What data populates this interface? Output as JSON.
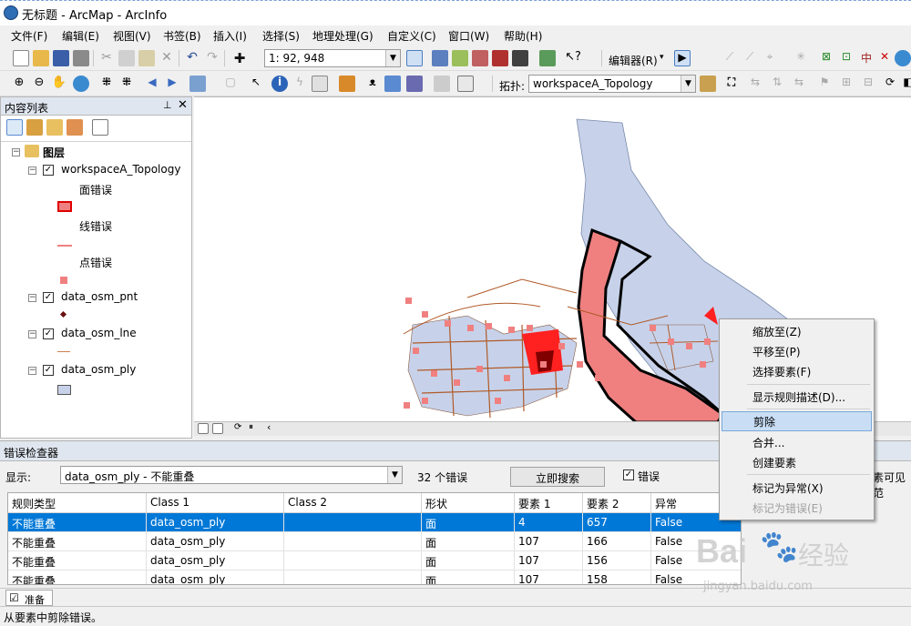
{
  "window": {
    "title": "无标题 - ArcMap - ArcInfo"
  },
  "menu": [
    "文件(F)",
    "编辑(E)",
    "视图(V)",
    "书签(B)",
    "插入(I)",
    "选择(S)",
    "地理处理(G)",
    "自定义(C)",
    "窗口(W)",
    "帮助(H)"
  ],
  "toolbar": {
    "scale": "1: 92, 948",
    "editor_label": "编辑器(R)",
    "topology_label": "拓扑:",
    "topology_value": "workspaceA_Topology"
  },
  "toc": {
    "title": "内容列表",
    "root": "图层",
    "topology_layer": "workspaceA_Topology",
    "legend": [
      "面错误",
      "线错误",
      "点错误"
    ],
    "layers": [
      "data_osm_pnt",
      "data_osm_lne",
      "data_osm_ply"
    ]
  },
  "error_inspector": {
    "title": "错误检查器",
    "show_label": "显示:",
    "show_value": "data_osm_ply - 不能重叠",
    "count": "32 个错误",
    "search_button": "立即搜索",
    "errors_checkbox": "错误",
    "visible_text": "素可见范",
    "columns": [
      "规则类型",
      "Class 1",
      "Class 2",
      "形状",
      "要素 1",
      "要素 2",
      "异常"
    ],
    "rows": [
      [
        "不能重叠",
        "data_osm_ply",
        "",
        "面",
        "4",
        "657",
        "False"
      ],
      [
        "不能重叠",
        "data_osm_ply",
        "",
        "面",
        "107",
        "166",
        "False"
      ],
      [
        "不能重叠",
        "data_osm_ply",
        "",
        "面",
        "107",
        "156",
        "False"
      ],
      [
        "不能重叠",
        "data_osm_ply",
        "",
        "面",
        "107",
        "158",
        "False"
      ]
    ]
  },
  "context_menu": {
    "items": [
      "缩放至(Z)",
      "平移至(P)",
      "选择要素(F)",
      "显示规则描述(D)...",
      "剪除",
      "合并...",
      "创建要素",
      "标记为异常(X)",
      "标记为错误(E)"
    ],
    "highlighted": "剪除",
    "disabled": "标记为错误(E)"
  },
  "status": {
    "tab": "准备",
    "message": "从要素中剪除错误。"
  },
  "watermark": {
    "brand": "Bai",
    "brand2": "经验",
    "url": "jingyan.baidu.com"
  },
  "colors": {
    "selection": "#0078d7",
    "highlight": "#c9def5",
    "error_fill": "#f08080",
    "polygon_fill": "#c7d2ea",
    "line_brown": "#b05a28"
  }
}
